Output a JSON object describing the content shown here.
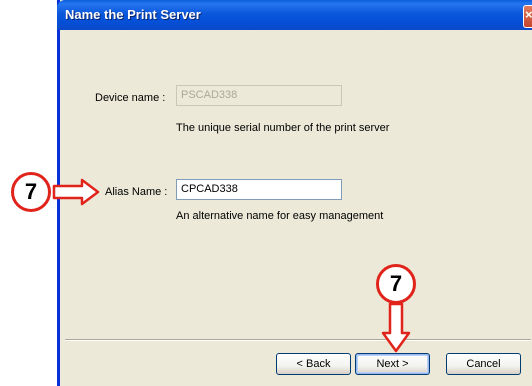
{
  "window": {
    "title": "Name the Print Server",
    "close_glyph": "×"
  },
  "device": {
    "label": "Device name :",
    "value": "PSCAD338",
    "help": "The unique serial number of the print server"
  },
  "alias": {
    "label": "Alias Name :",
    "value": "CPCAD338",
    "help": "An alternative name for easy management"
  },
  "buttons": {
    "back": "< Back",
    "next": "Next >",
    "cancel": "Cancel"
  },
  "callouts": {
    "alias_step": "7",
    "next_step": "7"
  },
  "colors": {
    "callout_border": "#e0241b",
    "arrow": "#e0241b",
    "titlebar": "#0b58dc",
    "dialog_bg": "#ece9d8"
  },
  "icons": {
    "close": "close-icon",
    "arrow_right": "arrow-right-icon",
    "arrow_down": "arrow-down-icon"
  }
}
